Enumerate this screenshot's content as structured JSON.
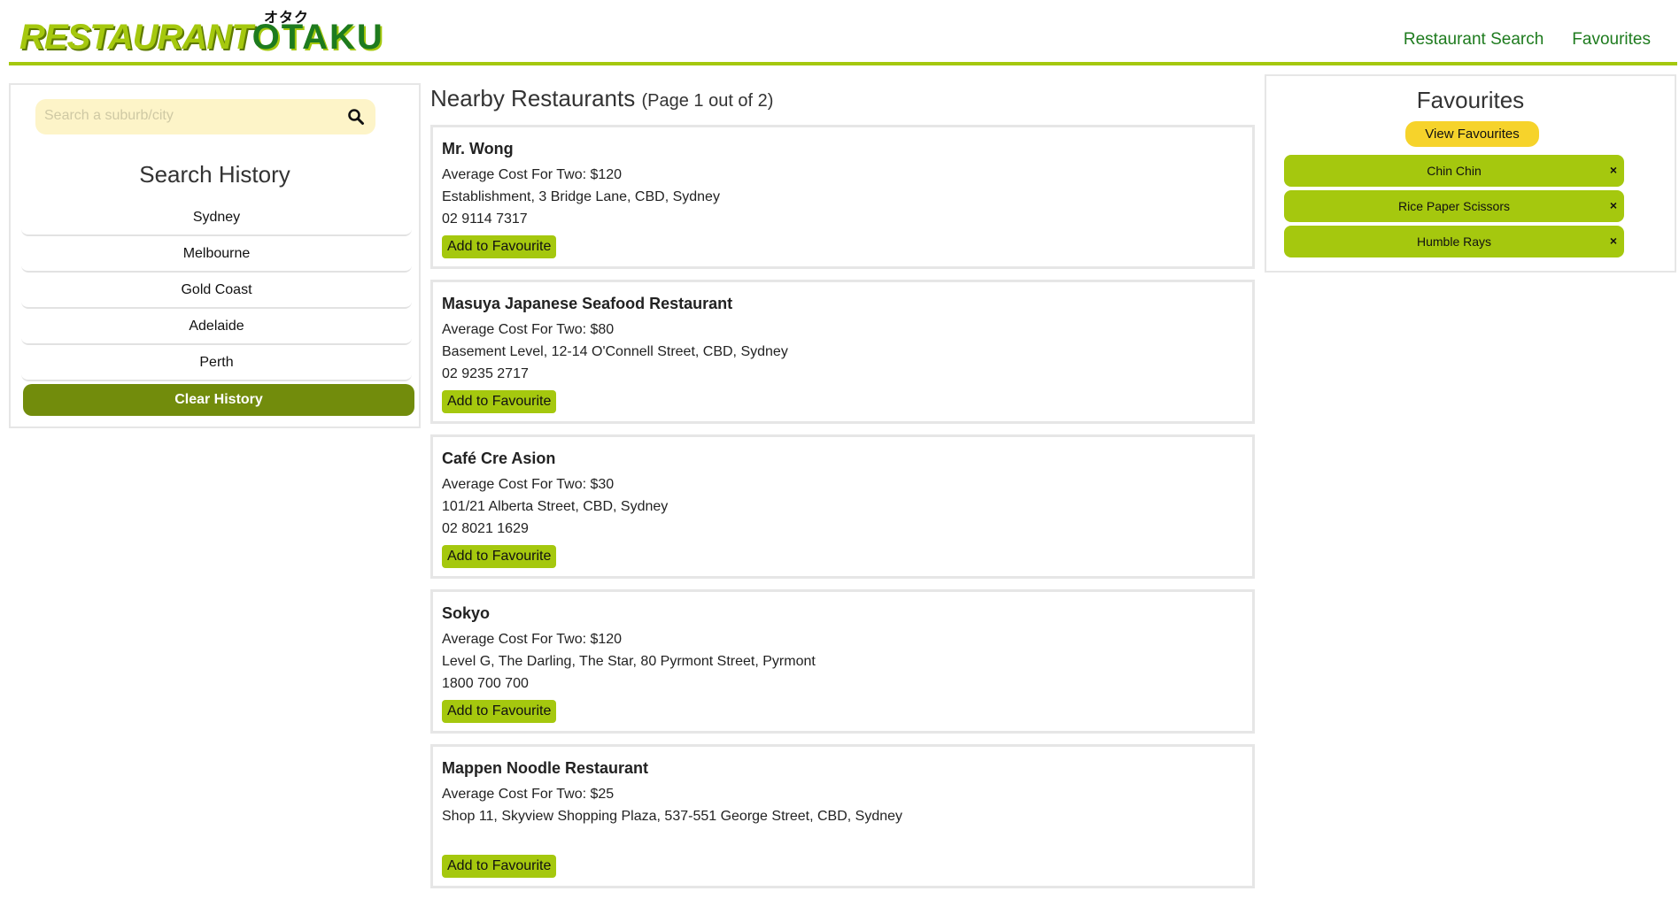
{
  "header": {
    "logo_part1": "RESTAURANT",
    "logo_part2": "OTAKU",
    "logo_kana": "オタク",
    "nav": [
      {
        "label": "Restaurant Search"
      },
      {
        "label": "Favourites"
      }
    ]
  },
  "search": {
    "placeholder": "Search a suburb/city",
    "icon": "search-icon"
  },
  "history": {
    "title": "Search History",
    "items": [
      "Sydney",
      "Melbourne",
      "Gold Coast",
      "Adelaide",
      "Perth"
    ],
    "clear_label": "Clear History"
  },
  "main": {
    "title": "Nearby Restaurants",
    "page_info": "(Page 1 out of 2)",
    "add_label": "Add to Favourite",
    "restaurants": [
      {
        "name": "Mr. Wong",
        "cost": "Average Cost For Two: $120",
        "address": "Establishment, 3 Bridge Lane, CBD, Sydney",
        "phone": "02 9114 7317"
      },
      {
        "name": "Masuya Japanese Seafood Restaurant",
        "cost": "Average Cost For Two: $80",
        "address": "Basement Level, 12-14 O'Connell Street, CBD, Sydney",
        "phone": "02 9235 2717"
      },
      {
        "name": "Café Cre Asion",
        "cost": "Average Cost For Two: $30",
        "address": "101/21 Alberta Street, CBD, Sydney",
        "phone": "02 8021 1629"
      },
      {
        "name": "Sokyo",
        "cost": "Average Cost For Two: $120",
        "address": "Level G, The Darling, The Star, 80 Pyrmont Street, Pyrmont",
        "phone": "1800 700 700"
      },
      {
        "name": "Mappen Noodle Restaurant",
        "cost": "Average Cost For Two: $25",
        "address": "Shop 11, Skyview Shopping Plaza, 537-551 George Street, CBD, Sydney",
        "phone": ""
      }
    ]
  },
  "favourites": {
    "title": "Favourites",
    "view_label": "View Favourites",
    "remove_glyph": "×",
    "items": [
      "Chin Chin",
      "Rice Paper Scissors",
      "Humble Rays"
    ]
  },
  "colors": {
    "accent_green": "#a5c80e",
    "dark_green": "#1e7b1e",
    "olive_button": "#728c0c",
    "yellow_button": "#f6d32b",
    "search_bg": "#fdf4c8"
  }
}
